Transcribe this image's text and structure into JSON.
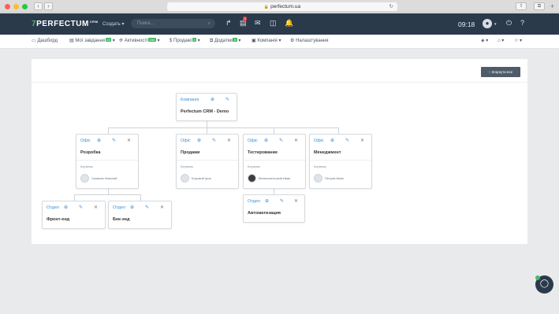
{
  "browser": {
    "url": "perfectum.ua"
  },
  "app": {
    "logo_mark": "7",
    "logo_text": "PERFECTUM",
    "logo_sup": "CRM",
    "create_label": "Создать ▾",
    "search_placeholder": "Поиск...",
    "notification_count": "3",
    "time": "09:18"
  },
  "menu": [
    {
      "label": "Дашборд",
      "badge": ""
    },
    {
      "label": "Мої завдання",
      "badge": "23"
    },
    {
      "label": "Активності",
      "badge": "243"
    },
    {
      "label": "Продажі",
      "badge": "3"
    },
    {
      "label": "Додатки",
      "badge": "5"
    },
    {
      "label": "Компанія",
      "badge": ""
    },
    {
      "label": "Налаштування",
      "badge": ""
    }
  ],
  "collapse_label": "Згорнути все",
  "org": {
    "root": {
      "type": "Компанія",
      "name": "Perfectum CRM - Demo"
    },
    "offices": [
      {
        "type": "Офіс",
        "name": "Розробка",
        "head_label": "Керівник",
        "head": "Хазанов Николай"
      },
      {
        "type": "Офіс",
        "name": "Продажи",
        "head_label": "Керівник",
        "head": "Боровий Ірин"
      },
      {
        "type": "Офіс",
        "name": "Тестирование",
        "head_label": "Керівник",
        "head": "Великозельский Иван"
      },
      {
        "type": "Офіс",
        "name": "Менеджмент",
        "head_label": "Керівник",
        "head": "Петров Иван"
      }
    ],
    "departments": [
      {
        "type": "Отдел",
        "name": "Фронт-енд"
      },
      {
        "type": "Отдел",
        "name": "Бек-энд"
      },
      {
        "type": "Отдел",
        "name": "Автоматизация"
      }
    ]
  }
}
